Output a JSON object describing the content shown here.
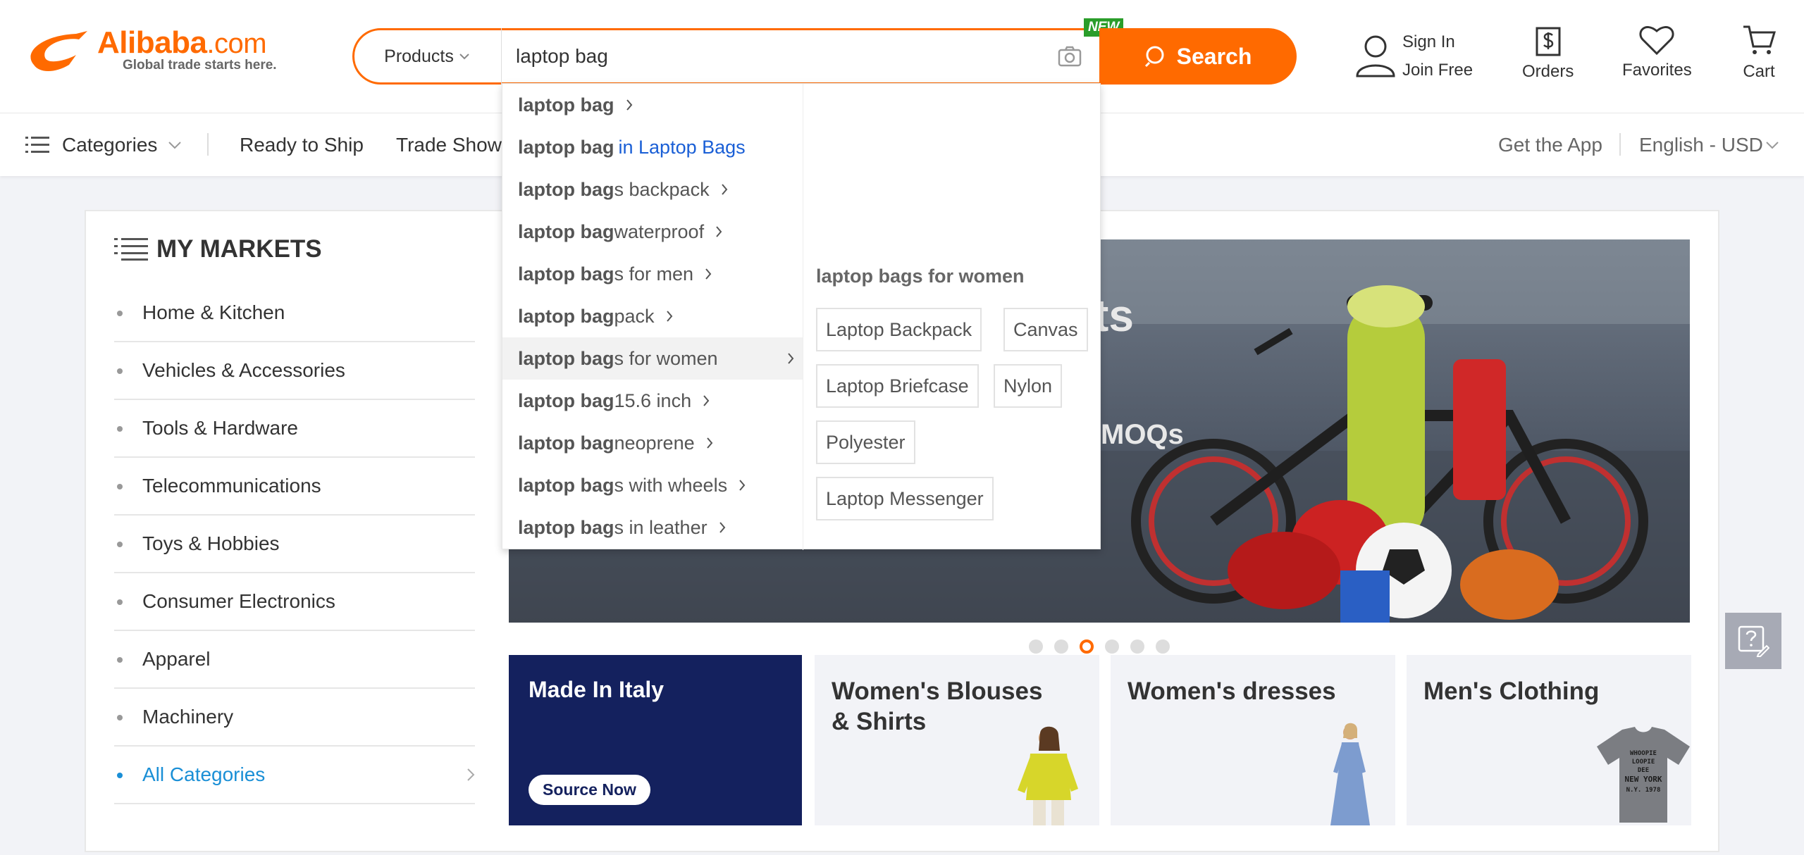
{
  "brand": {
    "name": "Alibaba",
    "domain_suffix": ".com",
    "tagline": "Global trade starts here.",
    "accent_color": "#ff6a00"
  },
  "search": {
    "category_label": "Products",
    "query": "laptop bag",
    "new_badge": "NEW",
    "button_label": "Search",
    "camera_icon": "camera-icon"
  },
  "header": {
    "sign_in": "Sign In",
    "join_free": "Join Free",
    "orders": "Orders",
    "favorites": "Favorites",
    "cart": "Cart"
  },
  "nav": {
    "categories": "Categories",
    "ready_to_ship": "Ready to Ship",
    "trade_shows": "Trade Show",
    "get_app": "Get the App",
    "language": "English - USD"
  },
  "markets": {
    "title": "MY MARKETS",
    "items": [
      "Home & Kitchen",
      "Vehicles & Accessories",
      "Tools & Hardware",
      "Telecommunications",
      "Toys & Hobbies",
      "Consumer Electronics",
      "Apparel",
      "Machinery"
    ],
    "all_categories": "All Categories"
  },
  "banner": {
    "text_fragment_1": "ts",
    "text_fragment_2": "MOQs",
    "slides_total": 6,
    "active_slide": 3
  },
  "tiles": {
    "italy_title": "Made In Italy",
    "italy_button": "Source Now",
    "blouses_title_1": "Women's Blouses",
    "blouses_title_2": "& Shirts",
    "dresses_title": "Women's dresses",
    "mens_title": "Men's Clothing",
    "tshirt_print": "WHOOPIE LOOPIE DEE NEW YORK N.Y. 1978"
  },
  "suggestions": {
    "items": [
      {
        "bold": "laptop bag",
        "rest": "",
        "extra": ""
      },
      {
        "bold": "laptop bag",
        "rest": "",
        "extra": "in Laptop Bags"
      },
      {
        "bold": "laptop bag",
        "rest": "s backpack",
        "extra": ""
      },
      {
        "bold": "laptop bag",
        "rest": " waterproof",
        "extra": ""
      },
      {
        "bold": "laptop bag",
        "rest": "s for men",
        "extra": ""
      },
      {
        "bold": "laptop bag",
        "rest": "pack",
        "extra": ""
      },
      {
        "bold": "laptop bag",
        "rest": "s for women",
        "extra": ""
      },
      {
        "bold": "laptop bag",
        "rest": " 15.6 inch",
        "extra": ""
      },
      {
        "bold": "laptop bag",
        "rest": " neoprene",
        "extra": ""
      },
      {
        "bold": "laptop bag",
        "rest": "s with wheels",
        "extra": ""
      },
      {
        "bold": "laptop bag",
        "rest": "s in leather",
        "extra": ""
      }
    ],
    "hovered_index": 6,
    "related_title": "laptop bags for women",
    "chips": [
      "Laptop Backpack",
      "Canvas",
      "Laptop Briefcase",
      "Nylon",
      "Polyester",
      "Laptop Messenger"
    ]
  }
}
